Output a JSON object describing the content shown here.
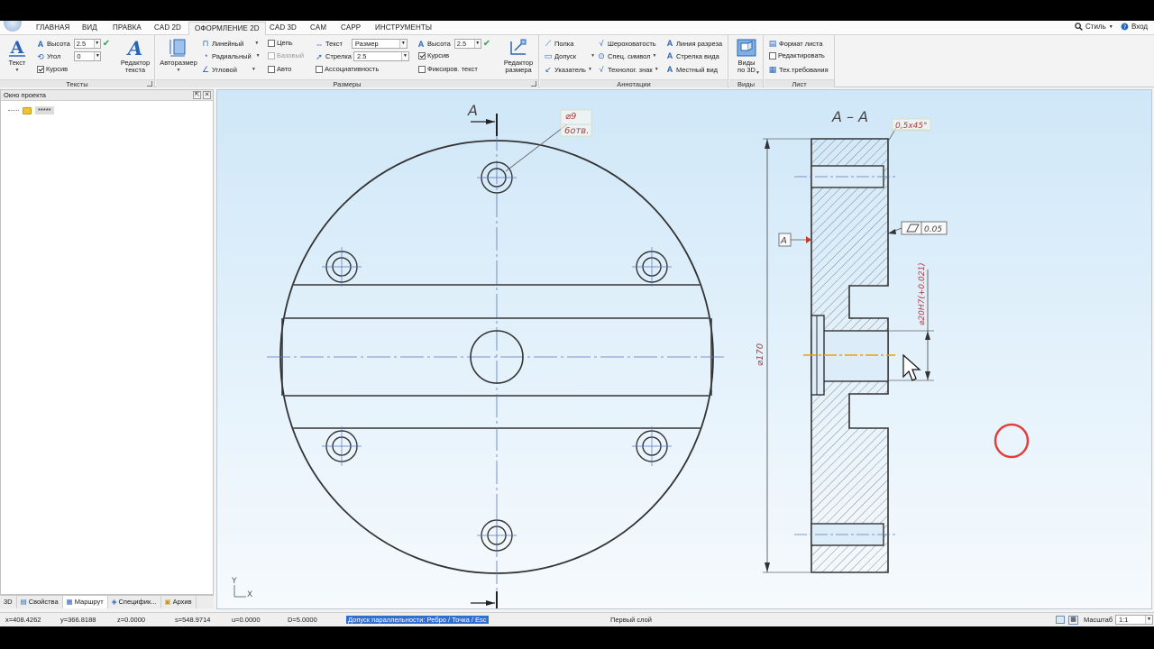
{
  "menu": {
    "tabs": [
      "ГЛАВНАЯ",
      "ВИД",
      "ПРАВКА",
      "CAD 2D",
      "ОФОРМЛЕНИЕ 2D",
      "CAD 3D",
      "CAM",
      "CAPP",
      "ИНСТРУМЕНТЫ"
    ],
    "active_tab": "ОФОРМЛЕНИЕ 2D",
    "style_label": "Стиль",
    "login_label": "Вход"
  },
  "ribbon": {
    "texts": {
      "title": "Тексты",
      "text_button": "Текст",
      "height_label": "Высота",
      "height_value": "2.5",
      "angle_label": "Угол",
      "angle_value": "0",
      "italic_label": "Курсив",
      "editor_button": "Редактор текста"
    },
    "dims": {
      "title": "Размеры",
      "autosize_button": "Авторазмер",
      "linear": "Линейный",
      "radial": "Радиальный",
      "angular": "Угловой",
      "chain": "Цепь",
      "base": "Базовый",
      "auto": "Авто",
      "text_label": "Текст",
      "text_value": "Размер",
      "arrow_label": "Стрелка",
      "arrow_value": "2.5",
      "assoc": "Ассоциативность",
      "height_label": "Высота",
      "height_value": "2.5",
      "italic": "Курсив",
      "fixed_text": "Фиксиров. текст",
      "editor_button": "Редактор размера"
    },
    "annot": {
      "title": "Аннотации",
      "shelf": "Полка",
      "tolerance": "Допуск",
      "pointer": "Указатель",
      "roughness": "Шероховатость",
      "special_symbol": "Спец. символ",
      "tech_mark": "Технолог. знак",
      "cut_line": "Линия разреза",
      "view_arrow": "Стрелка вида",
      "local_view": "Местный вид"
    },
    "views": {
      "title": "Виды",
      "button": "Виды по 3D"
    },
    "sheet": {
      "title": "Лист",
      "format": "Формат листа",
      "edit": "Редактировать",
      "tech_req": "Тех.требования"
    }
  },
  "project_panel": {
    "title": "Окно проекта",
    "item": "*****"
  },
  "bottom_tabs": [
    "3D",
    "Свойства",
    "Маршрут",
    "Специфик...",
    "Архив"
  ],
  "drawing": {
    "section_label_top": "A",
    "section_label_view": "A – A",
    "hole_dim_top": "⌀9",
    "hole_dim_bottom": "6отв.",
    "chamfer": "0,5x45°",
    "datum": "A",
    "parallelism_value": "0.05",
    "diameter_170": "⌀170",
    "bore_dim": "⌀20H7(+0.021)",
    "axis_x": "X",
    "axis_y": "Y"
  },
  "status": {
    "x": "x=408.4262",
    "y": "y=366.8188",
    "z": "z=0.0000",
    "s": "s=548.9714",
    "u": "u=0.0000",
    "d": "D=5.0000",
    "hint": "Допуск параллельности: Ребро / Точка / Esc",
    "layer": "Первый слой",
    "scale_label": "Масштаб",
    "scale_value": "1:1"
  }
}
